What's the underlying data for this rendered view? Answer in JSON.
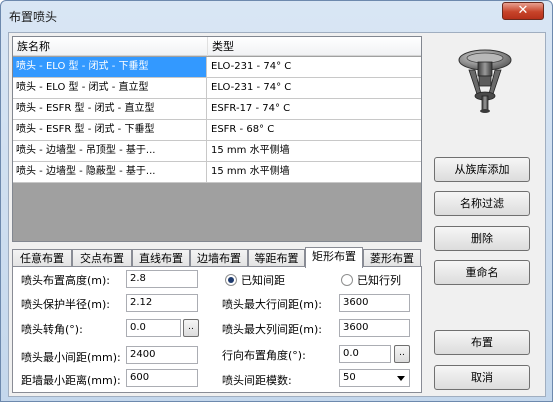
{
  "window": {
    "title": "布置喷头",
    "close_glyph": "✕"
  },
  "list": {
    "columns": [
      "族名称",
      "类型"
    ],
    "rows": [
      {
        "name": "喷头 - ELO 型 - 闭式 - 下垂型",
        "type": "ELO-231 - 74° C",
        "selected": true
      },
      {
        "name": "喷头 - ELO 型 - 闭式 - 直立型",
        "type": "ELO-231 - 74° C",
        "selected": false
      },
      {
        "name": "喷头 - ESFR 型 - 闭式 - 直立型",
        "type": "ESFR-17 - 74° C",
        "selected": false
      },
      {
        "name": "喷头 - ESFR 型 - 闭式 - 下垂型",
        "type": "ESFR - 68° C",
        "selected": false
      },
      {
        "name": "喷头 - 边墙型 - 吊顶型 - 基于...",
        "type": "15 mm 水平侧墙",
        "selected": false
      },
      {
        "name": "喷头 - 边墙型 - 隐蔽型 - 基于...",
        "type": "15 mm 水平侧墙",
        "selected": false
      }
    ]
  },
  "buttons": {
    "add_from_library": "从族库添加",
    "name_filter": "名称过滤",
    "delete": "删除",
    "rename": "重命名",
    "place": "布置",
    "cancel": "取消"
  },
  "tabs": [
    "任意布置",
    "交点布置",
    "直线布置",
    "边墙布置",
    "等距布置",
    "矩形布置",
    "菱形布置"
  ],
  "active_tab": "矩形布置",
  "form": {
    "height_label": "喷头布置高度(m):",
    "height_value": "2.8",
    "radius_label": "喷头保护半径(m):",
    "radius_value": "2.12",
    "rotation_label": "喷头转角(°):",
    "rotation_value": "0.0",
    "min_spacing_label": "喷头最小间距(mm):",
    "min_spacing_value": "2400",
    "wall_min_label": "距墙最小距离(mm):",
    "wall_min_value": "600",
    "radio_known_spacing": "已知间距",
    "radio_known_rowcol": "已知行列",
    "max_row_spacing_label": "喷头最大行间距(m):",
    "max_row_spacing_value": "3600",
    "max_col_spacing_label": "喷头最大列间距(m):",
    "max_col_spacing_value": "3600",
    "row_angle_label": "行向布置角度(°):",
    "row_angle_value": "0.0",
    "modulus_label": "喷头间距模数:",
    "modulus_value": "50",
    "ellipsis": ".."
  },
  "colors": {
    "selection": "#3399ff",
    "title_bar": "#c4d7ec",
    "close_button": "#c7442a"
  },
  "icons": {
    "preview": "sprinkler-head-icon",
    "close": "close-icon",
    "dropdown": "chevron-down-icon"
  }
}
